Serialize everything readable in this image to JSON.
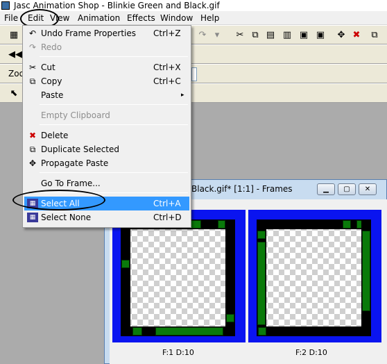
{
  "app": {
    "title": "Jasc Animation Shop - Blinkie Green and Black.gif"
  },
  "menubar": {
    "items": [
      "File",
      "Edit",
      "View",
      "Animation",
      "Effects",
      "Window",
      "Help"
    ]
  },
  "toolbar": {
    "zoom_label": "Zoo"
  },
  "edit_menu": {
    "items": [
      {
        "label": "Undo Frame Properties",
        "shortcut": "Ctrl+Z",
        "icon": "undo-icon",
        "disabled": false
      },
      {
        "label": "Redo",
        "shortcut": "",
        "icon": "redo-icon",
        "disabled": true
      },
      {
        "label": "Cut",
        "shortcut": "Ctrl+X",
        "icon": "scissors-icon",
        "disabled": false
      },
      {
        "label": "Copy",
        "shortcut": "Ctrl+C",
        "icon": "copy-icon",
        "disabled": false
      },
      {
        "label": "Paste",
        "shortcut": "",
        "icon": "",
        "disabled": false,
        "submenu": "▸"
      },
      {
        "label": "Empty Clipboard",
        "shortcut": "",
        "icon": "",
        "disabled": true
      },
      {
        "label": "Delete",
        "shortcut": "",
        "icon": "delete-icon",
        "disabled": false
      },
      {
        "label": "Duplicate Selected",
        "shortcut": "",
        "icon": "duplicate-icon",
        "disabled": false
      },
      {
        "label": "Propagate Paste",
        "shortcut": "",
        "icon": "propagate-icon",
        "disabled": false
      },
      {
        "label": "Go To Frame...",
        "shortcut": "",
        "icon": "",
        "disabled": false
      },
      {
        "label": "Select All",
        "shortcut": "Ctrl+A",
        "icon": "select-all-icon",
        "disabled": false,
        "highlighted": true
      },
      {
        "label": "Select None",
        "shortcut": "Ctrl+D",
        "icon": "select-none-icon",
        "disabled": false
      }
    ]
  },
  "frames_window": {
    "title": "Black.gif* [1:1] - Frames",
    "frames": [
      {
        "label": "F:1  D:10"
      },
      {
        "label": "F:2  D:10"
      }
    ]
  },
  "colors": {
    "frame_border": "#0a14f0",
    "selection_highlight": "#3399ff",
    "bar_green": "#0a7a0a",
    "selected_marker": "#e02020"
  }
}
